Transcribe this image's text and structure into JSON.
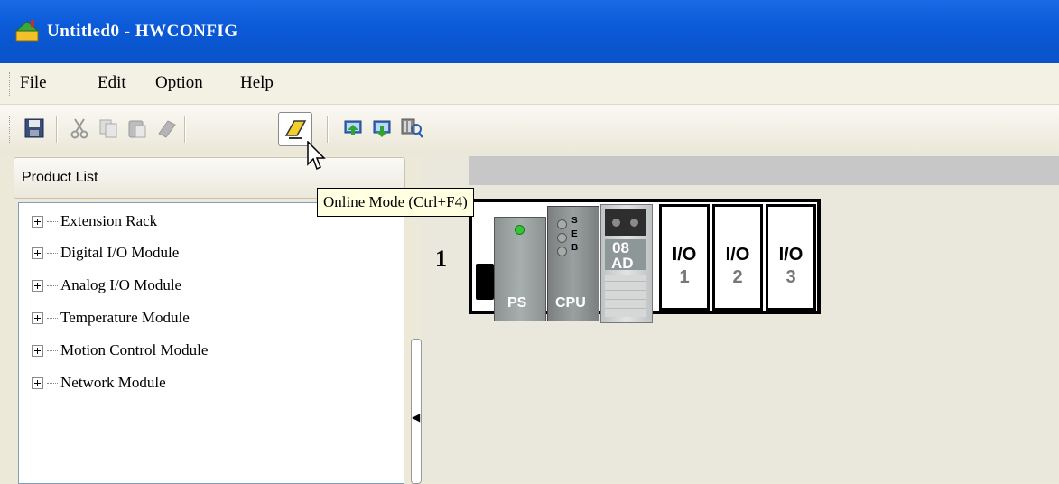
{
  "window": {
    "title": "Untitled0 - HWCONFIG"
  },
  "menu": {
    "items": [
      "File",
      "Edit",
      "Option",
      "Help"
    ]
  },
  "toolbar": {
    "buttons": [
      "save-icon",
      "cut-icon",
      "copy-icon",
      "paste-icon",
      "erase-icon",
      "online-mode-icon",
      "upload-icon",
      "download-icon",
      "scan-icon"
    ],
    "tooltip": "Online Mode (Ctrl+F4)"
  },
  "product_list": {
    "title": "Product List",
    "items": [
      "Extension Rack",
      "Digital I/O Module",
      "Analog I/O Module",
      "Temperature Module",
      "Motion Control Module",
      "Network Module"
    ]
  },
  "rack": {
    "number": "1",
    "modules": {
      "ps": "PS",
      "cpu": "CPU",
      "cpu_leds": [
        "S",
        "E",
        "B"
      ],
      "ad_line1": "08",
      "ad_line2": "AD"
    },
    "slots": [
      {
        "label": "I/O",
        "num": "1"
      },
      {
        "label": "I/O",
        "num": "2"
      },
      {
        "label": "I/O",
        "num": "3"
      }
    ]
  },
  "colors": {
    "titlebar": "#0b5ad8",
    "tooltip_bg": "#ffffe1",
    "led_green": "#35c435"
  }
}
